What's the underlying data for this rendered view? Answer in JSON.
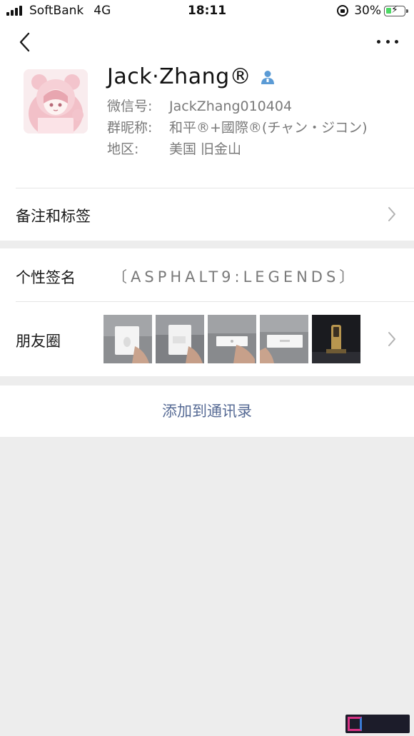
{
  "status_bar": {
    "carrier": "SoftBank",
    "network": "4G",
    "time": "18:11",
    "battery": "30%",
    "battery_level": 0.3
  },
  "profile": {
    "name": "Jack·Zhang®",
    "wechat_id_label": "微信号:",
    "wechat_id": "JackZhang010404",
    "group_nick_label": "群昵称:",
    "group_nick": "和平®+國際®(チャン・ジコン)",
    "region_label": "地区:",
    "region": "美国 旧金山"
  },
  "rows": {
    "remark_label": "备注和标签",
    "signature_label": "个性签名",
    "signature": "〔ASPHALT9:LEGENDS〕",
    "moments_label": "朋友圈"
  },
  "actions": {
    "add_contact": "添加到通讯录"
  },
  "colors": {
    "link": "#576b95",
    "contact_icon": "#5b9bd5",
    "background": "#ededed"
  }
}
